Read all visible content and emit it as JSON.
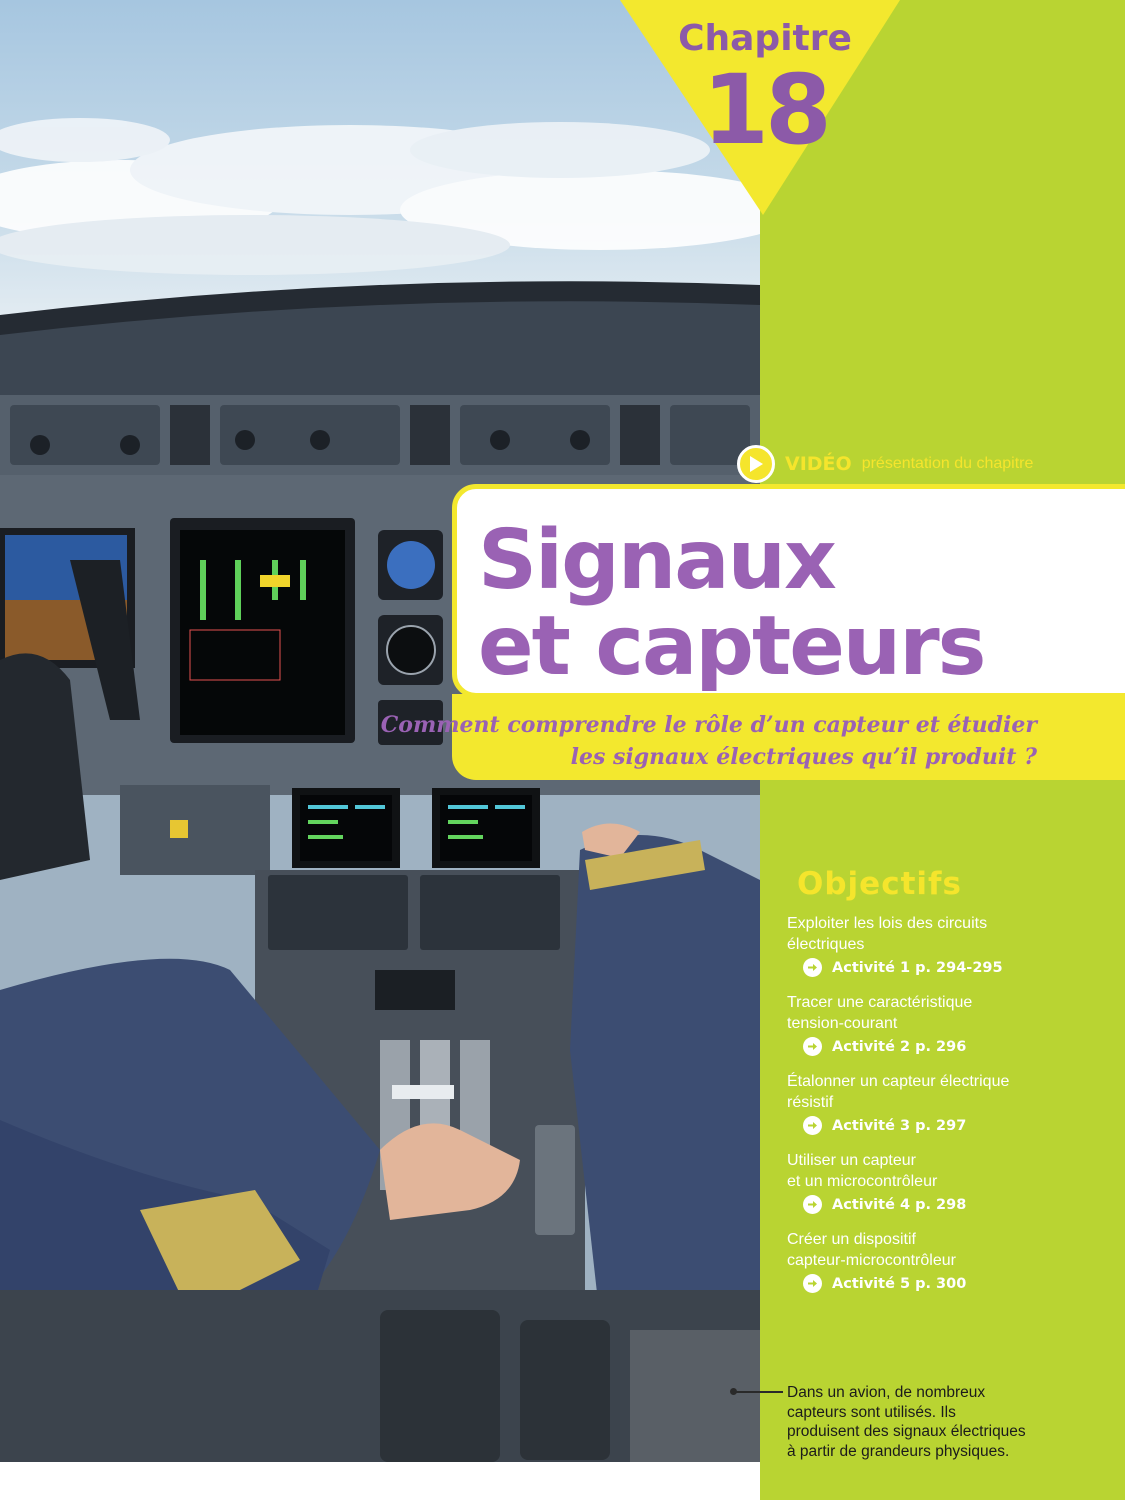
{
  "chapter": {
    "word": "Chapitre",
    "number": "18"
  },
  "video": {
    "label": "VIDÉO",
    "description": "présentation du chapitre"
  },
  "title": {
    "line1": "Signaux",
    "line2": "et capteurs"
  },
  "question": {
    "line1": "Comment comprendre le rôle d’un capteur et étudier",
    "line2": "les signaux électriques qu’il produit ?"
  },
  "objectives": {
    "heading": "Objectifs",
    "items": [
      {
        "line1": "Exploiter les lois des circuits",
        "line2": "électriques",
        "activity": "Activité 1 p. 294-295"
      },
      {
        "line1": "Tracer une caractéristique",
        "line2": "tension-courant",
        "activity": "Activité 2 p. 296"
      },
      {
        "line1": "Étalonner un capteur électrique",
        "line2": "résistif",
        "activity": "Activité 3 p. 297"
      },
      {
        "line1": "Utiliser un capteur",
        "line2": "et un microcontrôleur",
        "activity": "Activité 4 p. 298"
      },
      {
        "line1": "Créer un dispositif",
        "line2": "capteur-microcontrôleur",
        "activity": "Activité 5 p. 300"
      }
    ]
  },
  "caption": {
    "line1": "Dans un avion, de nombreux",
    "line2": "capteurs sont utilisés. Ils",
    "line3": "produisent des signaux électriques",
    "line4": "à partir de grandeurs physiques."
  },
  "colors": {
    "background_green": "#b9d432",
    "purple": "#9a62b4",
    "yellow": "#f3e82e"
  }
}
